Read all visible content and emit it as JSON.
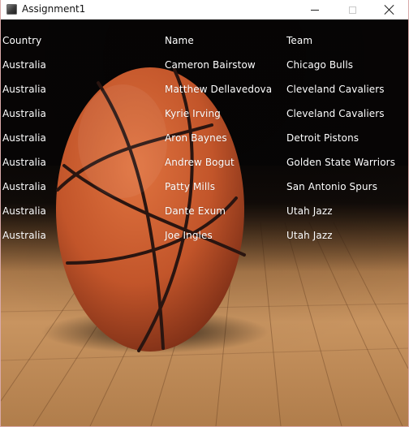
{
  "window": {
    "title": "Assignment1",
    "minimize_icon": "minimize-icon",
    "maximize_icon": "maximize-icon",
    "close_icon": "close-icon"
  },
  "table": {
    "headers": [
      "Country",
      "Name",
      "Team"
    ],
    "rows": [
      [
        "Australia",
        "Cameron Bairstow",
        "Chicago Bulls"
      ],
      [
        "Australia",
        "Matthew Dellavedova",
        "Cleveland Cavaliers"
      ],
      [
        "Australia",
        "Kyrie Irving",
        "Cleveland Cavaliers"
      ],
      [
        "Australia",
        "Aron Baynes",
        "Detroit Pistons"
      ],
      [
        "Australia",
        "Andrew Bogut",
        "Golden State Warriors"
      ],
      [
        "Australia",
        "Patty Mills",
        "San Antonio Spurs"
      ],
      [
        "Australia",
        "Dante Exum",
        "Utah Jazz"
      ],
      [
        "Australia",
        "Joe Ingles",
        "Utah Jazz"
      ]
    ]
  },
  "colors": {
    "text": "#ffffff",
    "background": "#0b0807",
    "ball": "#c5552a",
    "floor": "#b98a58"
  },
  "background_image": "basketball-on-wooden-court"
}
